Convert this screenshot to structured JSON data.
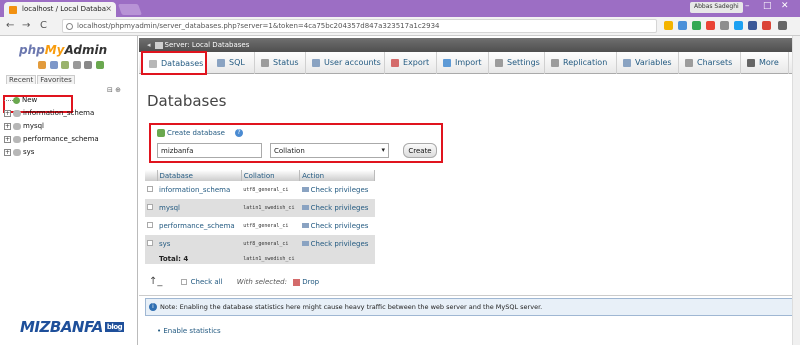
{
  "browser": {
    "tab_title": "localhost / Local Databa",
    "tab_close": "×",
    "url": "localhost/phpmyadmin/server_databases.php?server=1&token=4ca75bc204357d847a323517a1c2934",
    "user": "Abbas Sadeghi",
    "win_min": "–",
    "win_max": "□",
    "win_close": "✕",
    "back": "←",
    "forward": "→",
    "reload": "C"
  },
  "left": {
    "logo_php": "php",
    "logo_my": "My",
    "logo_admin": "Admin",
    "tab_recent": "Recent",
    "tab_favorites": "Favorites",
    "collapse": "⊟ ⊕",
    "new_label": "New",
    "databases": [
      "information_schema",
      "mysql",
      "performance_schema",
      "sys"
    ],
    "brand": "MIZBANFA",
    "brand_tag": "blog"
  },
  "header": {
    "breadcrumb": "Server: Local Databases"
  },
  "tabs": [
    {
      "label": "Databases",
      "color": "#b7b7b7"
    },
    {
      "label": "SQL",
      "color": "#8aa3c2"
    },
    {
      "label": "Status",
      "color": "#9c9c9c"
    },
    {
      "label": "User accounts",
      "color": "#8aa3c2"
    },
    {
      "label": "Export",
      "color": "#d46b6b"
    },
    {
      "label": "Import",
      "color": "#5d9ad6"
    },
    {
      "label": "Settings",
      "color": "#9c9c9c"
    },
    {
      "label": "Replication",
      "color": "#9c9c9c"
    },
    {
      "label": "Variables",
      "color": "#8aa3c2"
    },
    {
      "label": "Charsets",
      "color": "#9c9c9c"
    },
    {
      "label": "More",
      "color": "#666666"
    }
  ],
  "page": {
    "title": "Databases"
  },
  "create": {
    "label": "Create database",
    "name_value": "mizbanfa",
    "collation": "Collation",
    "button": "Create"
  },
  "table": {
    "headers": [
      "Database",
      "Collation",
      "Action"
    ],
    "rows": [
      {
        "name": "information_schema",
        "collation": "utf8_general_ci",
        "action": "Check privileges"
      },
      {
        "name": "mysql",
        "collation": "latin1_swedish_ci",
        "action": "Check privileges"
      },
      {
        "name": "performance_schema",
        "collation": "utf8_general_ci",
        "action": "Check privileges"
      },
      {
        "name": "sys",
        "collation": "utf8_general_ci",
        "action": "Check privileges"
      }
    ],
    "total_label": "Total: 4",
    "total_collation": "latin1_swedish_ci"
  },
  "bulk": {
    "check_all": "Check all",
    "with_selected": "With selected:",
    "drop": "Drop"
  },
  "notice": {
    "text": "Note: Enabling the database statistics here might cause heavy traffic between the web server and the MySQL server."
  },
  "enable_statistics": "Enable statistics"
}
